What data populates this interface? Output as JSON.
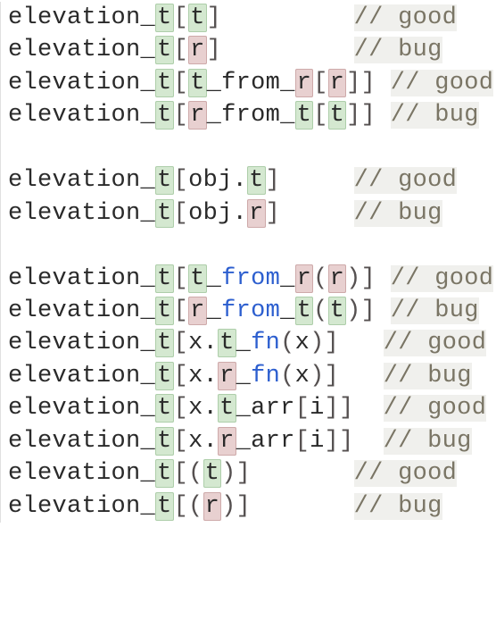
{
  "lines": [
    {
      "type": "code",
      "parts": [
        {
          "t": "elevation_"
        },
        {
          "t": "t",
          "c": "g"
        },
        {
          "t": "[",
          "c": "br"
        },
        {
          "t": "t",
          "c": "g"
        },
        {
          "t": "]",
          "c": "br"
        },
        {
          "t": "         "
        },
        {
          "t": "// good",
          "c": "cm"
        }
      ]
    },
    {
      "type": "code",
      "parts": [
        {
          "t": "elevation_"
        },
        {
          "t": "t",
          "c": "g"
        },
        {
          "t": "[",
          "c": "br"
        },
        {
          "t": "r",
          "c": "r"
        },
        {
          "t": "]",
          "c": "br"
        },
        {
          "t": "         "
        },
        {
          "t": "// bug",
          "c": "cm"
        }
      ]
    },
    {
      "type": "code",
      "parts": [
        {
          "t": "elevation_"
        },
        {
          "t": "t",
          "c": "g"
        },
        {
          "t": "[",
          "c": "br"
        },
        {
          "t": "t",
          "c": "g"
        },
        {
          "t": "_from_"
        },
        {
          "t": "r",
          "c": "r"
        },
        {
          "t": "[",
          "c": "br"
        },
        {
          "t": "r",
          "c": "r"
        },
        {
          "t": "]]",
          "c": "br"
        },
        {
          "t": " "
        },
        {
          "t": "// good",
          "c": "cm"
        }
      ]
    },
    {
      "type": "code",
      "parts": [
        {
          "t": "elevation_"
        },
        {
          "t": "t",
          "c": "g"
        },
        {
          "t": "[",
          "c": "br"
        },
        {
          "t": "r",
          "c": "r"
        },
        {
          "t": "_from_"
        },
        {
          "t": "t",
          "c": "g"
        },
        {
          "t": "[",
          "c": "br"
        },
        {
          "t": "t",
          "c": "g"
        },
        {
          "t": "]]",
          "c": "br"
        },
        {
          "t": " "
        },
        {
          "t": "// bug",
          "c": "cm"
        }
      ]
    },
    {
      "type": "blank"
    },
    {
      "type": "code",
      "parts": [
        {
          "t": "elevation_"
        },
        {
          "t": "t",
          "c": "g"
        },
        {
          "t": "[",
          "c": "br"
        },
        {
          "t": "obj."
        },
        {
          "t": "t",
          "c": "g"
        },
        {
          "t": "]",
          "c": "br"
        },
        {
          "t": "     "
        },
        {
          "t": "// good",
          "c": "cm"
        }
      ]
    },
    {
      "type": "code",
      "parts": [
        {
          "t": "elevation_"
        },
        {
          "t": "t",
          "c": "g"
        },
        {
          "t": "[",
          "c": "br"
        },
        {
          "t": "obj."
        },
        {
          "t": "r",
          "c": "r"
        },
        {
          "t": "]",
          "c": "br"
        },
        {
          "t": "     "
        },
        {
          "t": "// bug",
          "c": "cm"
        }
      ]
    },
    {
      "type": "blank"
    },
    {
      "type": "code",
      "parts": [
        {
          "t": "elevation_"
        },
        {
          "t": "t",
          "c": "g"
        },
        {
          "t": "[",
          "c": "br"
        },
        {
          "t": "t",
          "c": "g"
        },
        {
          "t": "_"
        },
        {
          "t": "from",
          "c": "fn"
        },
        {
          "t": "_"
        },
        {
          "t": "r",
          "c": "r"
        },
        {
          "t": "(",
          "c": "br"
        },
        {
          "t": "r",
          "c": "r"
        },
        {
          "t": ")]",
          "c": "br"
        },
        {
          "t": " "
        },
        {
          "t": "// good",
          "c": "cm"
        }
      ]
    },
    {
      "type": "code",
      "parts": [
        {
          "t": "elevation_"
        },
        {
          "t": "t",
          "c": "g"
        },
        {
          "t": "[",
          "c": "br"
        },
        {
          "t": "r",
          "c": "r"
        },
        {
          "t": "_"
        },
        {
          "t": "from",
          "c": "fn"
        },
        {
          "t": "_"
        },
        {
          "t": "t",
          "c": "g"
        },
        {
          "t": "(",
          "c": "br"
        },
        {
          "t": "t",
          "c": "g"
        },
        {
          "t": ")]",
          "c": "br"
        },
        {
          "t": " "
        },
        {
          "t": "// bug",
          "c": "cm"
        }
      ]
    },
    {
      "type": "code",
      "parts": [
        {
          "t": "elevation_"
        },
        {
          "t": "t",
          "c": "g"
        },
        {
          "t": "[",
          "c": "br"
        },
        {
          "t": "x."
        },
        {
          "t": "t",
          "c": "g"
        },
        {
          "t": "_"
        },
        {
          "t": "fn",
          "c": "fn"
        },
        {
          "t": "(",
          "c": "br"
        },
        {
          "t": "x"
        },
        {
          "t": ")]",
          "c": "br"
        },
        {
          "t": "   "
        },
        {
          "t": "// good",
          "c": "cm"
        }
      ]
    },
    {
      "type": "code",
      "parts": [
        {
          "t": "elevation_"
        },
        {
          "t": "t",
          "c": "g"
        },
        {
          "t": "[",
          "c": "br"
        },
        {
          "t": "x."
        },
        {
          "t": "r",
          "c": "r"
        },
        {
          "t": "_"
        },
        {
          "t": "fn",
          "c": "fn"
        },
        {
          "t": "(",
          "c": "br"
        },
        {
          "t": "x"
        },
        {
          "t": ")]",
          "c": "br"
        },
        {
          "t": "   "
        },
        {
          "t": "// bug",
          "c": "cm"
        }
      ]
    },
    {
      "type": "code",
      "parts": [
        {
          "t": "elevation_"
        },
        {
          "t": "t",
          "c": "g"
        },
        {
          "t": "[",
          "c": "br"
        },
        {
          "t": "x."
        },
        {
          "t": "t",
          "c": "g"
        },
        {
          "t": "_arr"
        },
        {
          "t": "[",
          "c": "br"
        },
        {
          "t": "i"
        },
        {
          "t": "]]",
          "c": "br"
        },
        {
          "t": "  "
        },
        {
          "t": "// good",
          "c": "cm"
        }
      ]
    },
    {
      "type": "code",
      "parts": [
        {
          "t": "elevation_"
        },
        {
          "t": "t",
          "c": "g"
        },
        {
          "t": "[",
          "c": "br"
        },
        {
          "t": "x."
        },
        {
          "t": "r",
          "c": "r"
        },
        {
          "t": "_arr"
        },
        {
          "t": "[",
          "c": "br"
        },
        {
          "t": "i"
        },
        {
          "t": "]]",
          "c": "br"
        },
        {
          "t": "  "
        },
        {
          "t": "// bug",
          "c": "cm"
        }
      ]
    },
    {
      "type": "code",
      "parts": [
        {
          "t": "elevation_"
        },
        {
          "t": "t",
          "c": "g"
        },
        {
          "t": "[(",
          "c": "br"
        },
        {
          "t": "t",
          "c": "g"
        },
        {
          "t": ")]",
          "c": "br"
        },
        {
          "t": "       "
        },
        {
          "t": "// good",
          "c": "cm"
        }
      ]
    },
    {
      "type": "code",
      "parts": [
        {
          "t": "elevation_"
        },
        {
          "t": "t",
          "c": "g"
        },
        {
          "t": "[(",
          "c": "br"
        },
        {
          "t": "r",
          "c": "r"
        },
        {
          "t": ")]",
          "c": "br"
        },
        {
          "t": "       "
        },
        {
          "t": "// bug",
          "c": "cm"
        }
      ]
    }
  ]
}
